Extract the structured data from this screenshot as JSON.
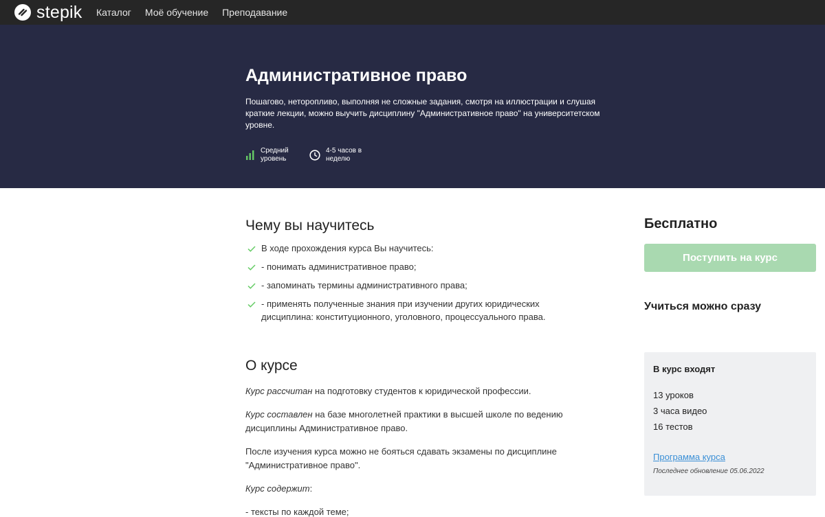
{
  "nav": {
    "logo_text": "stepik",
    "items": [
      "Каталог",
      "Моё обучение",
      "Преподавание"
    ]
  },
  "hero": {
    "title": "Административное право",
    "description": "Пошагово, неторопливо, выполняя не сложные задания, смотря на иллюстрации и слушая краткие лекции, можно выучить дисциплину \"Административное право\" на университетском уровне.",
    "level_line1": "Средний",
    "level_line2": "уровень",
    "time_line1": "4-5 часов в",
    "time_line2": "неделю",
    "level_icon": "level-bars-icon",
    "time_icon": "clock-icon"
  },
  "learn": {
    "heading": "Чему вы научитесь",
    "items": [
      "В ходе прохождения курса Вы научитесь:",
      "- понимать административное право;",
      "- запоминать термины административного права;",
      "- применять полученные знания при изучении других юридических дисциплина: конституционного, уголовного, процессуального права."
    ]
  },
  "about": {
    "heading": "О курсе",
    "p1_em": "Курс рассчитан",
    "p1_rest": " на подготовку студентов к юридической профессии.",
    "p2_em": "Курс составлен",
    "p2_rest": " на базе многолетней практики в высшей школе по ведению дисциплины Административное право.",
    "p3": "После изучения курса можно не бояться сдавать экзамены по дисциплине \"Административное право\".",
    "p4_em": "Курс содержит",
    "p4_rest": ":",
    "p5": "- тексты по каждой теме;"
  },
  "sidebar": {
    "price": "Бесплатно",
    "enroll_label": "Поступить на курс",
    "start_now": "Учиться можно сразу",
    "includes_title": "В курс входят",
    "lessons_num": "13",
    "lessons_label": " уроков",
    "video_num": "3",
    "video_label": " часа видео",
    "tests_num": "16",
    "tests_label": " тестов",
    "program_link": "Программа курса",
    "updated": "Последнее обновление 05.06.2022"
  },
  "colors": {
    "topbar": "#262626",
    "hero": "#272a44",
    "accent_green": "#66cc66",
    "button_disabled": "#a9d9b0",
    "link": "#3a8fd6"
  }
}
